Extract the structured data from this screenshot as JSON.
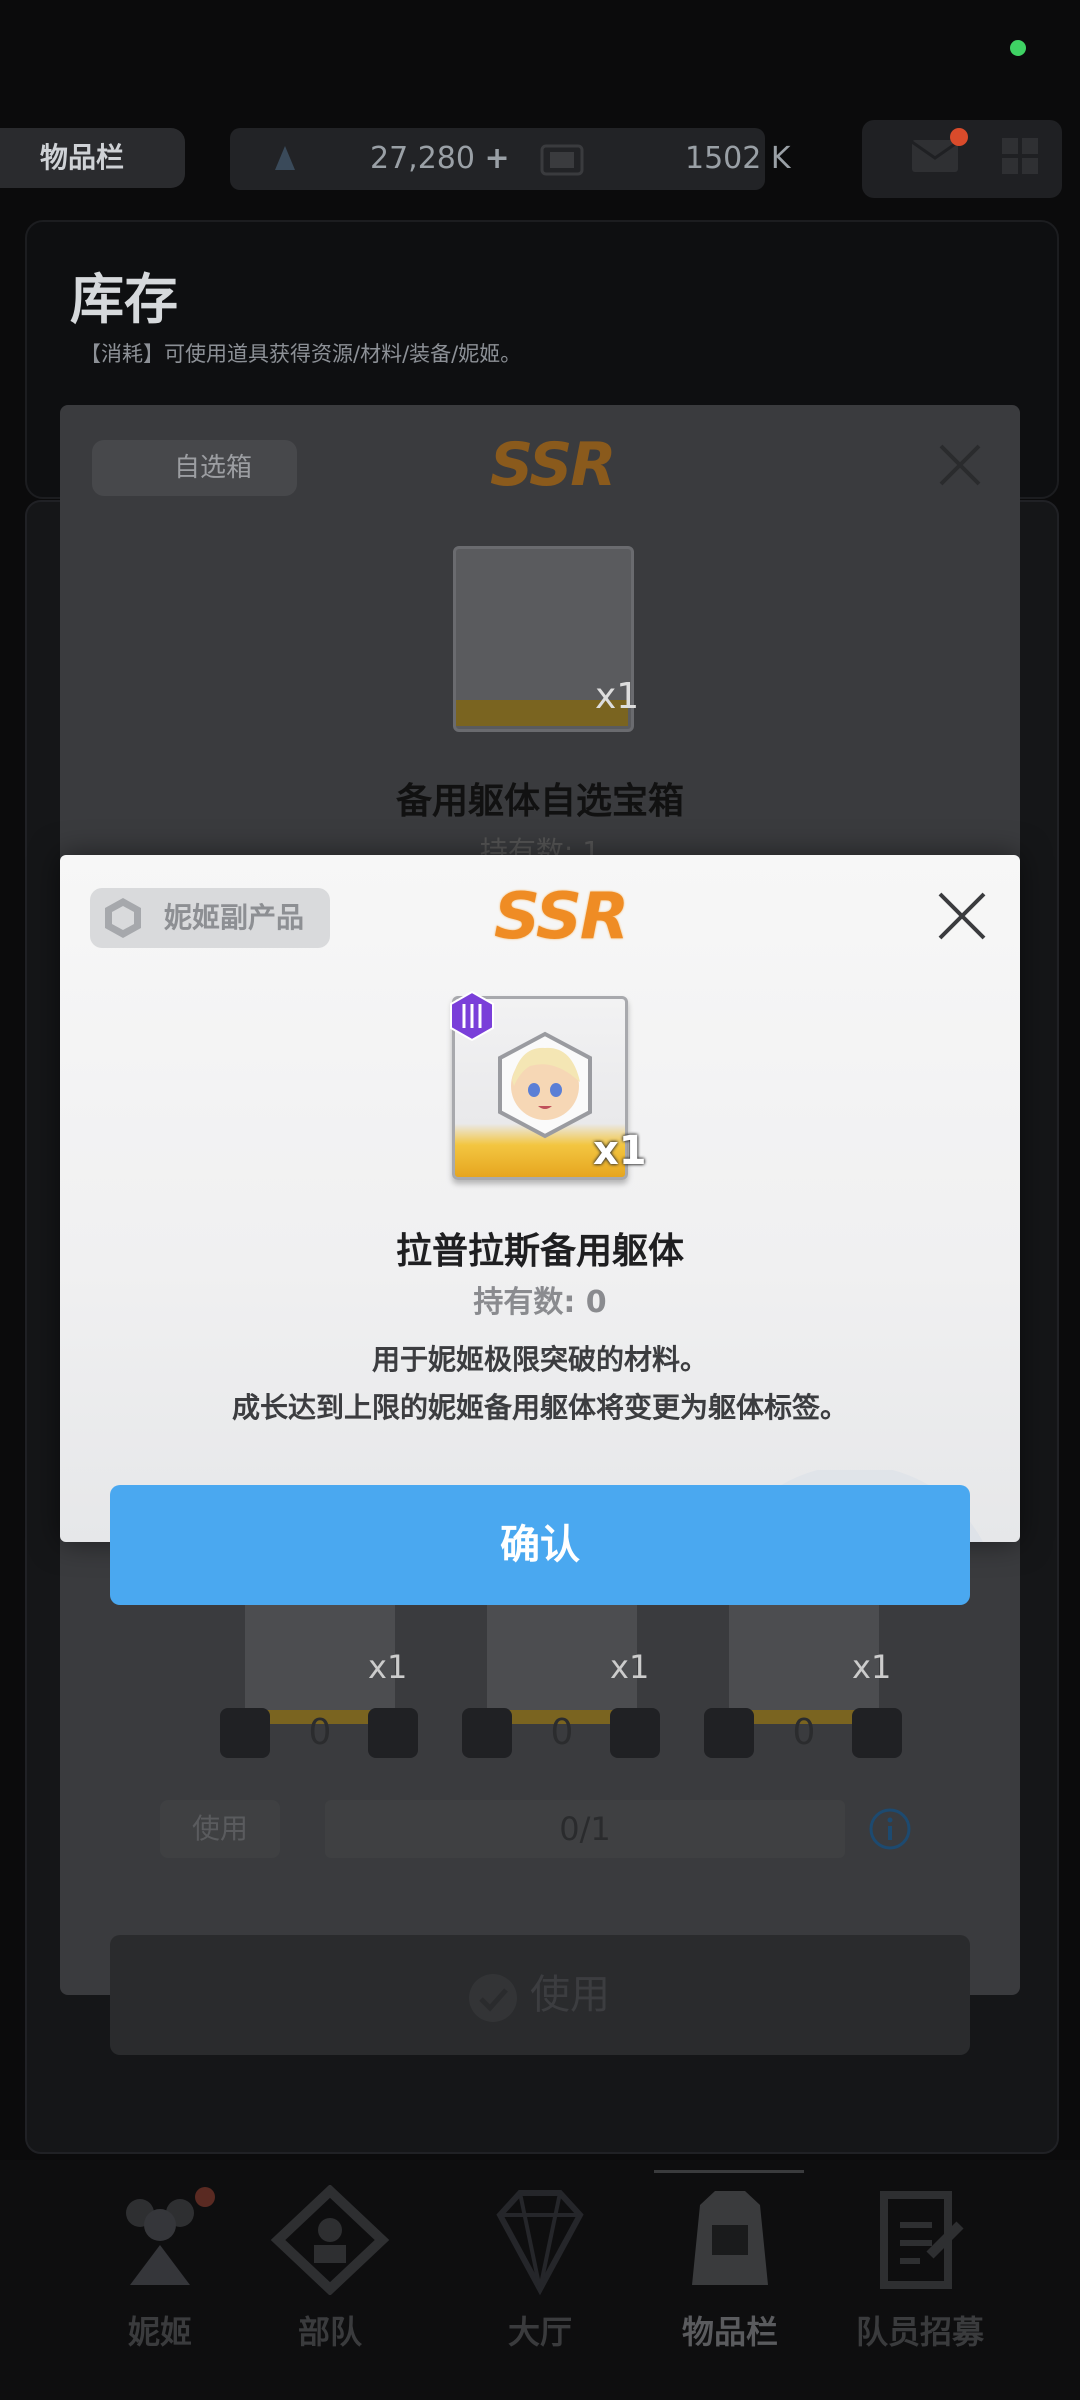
{
  "topbar": {
    "menu_label": "物品栏",
    "resource1_value": "27,280",
    "resource1_plus": "+",
    "resource2_value": "1502 K"
  },
  "inventory": {
    "title": "库存",
    "subtitle": "【消耗】可使用道具获得资源/材料/装备/妮姬。"
  },
  "background_dialog": {
    "tag_label": "自选箱",
    "rarity": "SSR",
    "item_name": "备用躯体自选宝箱",
    "held_label": "持有数: 1",
    "choice_qty_label": "x1",
    "pick_cards": [
      {
        "qty": "x1",
        "count": "0"
      },
      {
        "qty": "x1",
        "count": "0"
      },
      {
        "qty": "x1",
        "count": "0"
      }
    ],
    "use_small_label": "使用",
    "selection_count": "0/1",
    "use_button_label": "使用"
  },
  "dialog": {
    "tag_label": "妮姬副产品",
    "rarity": "SSR",
    "rarity_color": "#ef8c24",
    "item_qty": "x1",
    "item_name": "拉普拉斯备用躯体",
    "held_label": "持有数: 0",
    "description_line1": "用于妮姬极限突破的材料。",
    "description_line2": "成长达到上限的妮姬备用躯体将变更为躯体标签。",
    "confirm_label": "确认",
    "confirm_color": "#4aa8f0"
  },
  "nav": {
    "items": [
      {
        "label": "妮姬",
        "icon": "nikke-icon"
      },
      {
        "label": "部队",
        "icon": "squad-icon"
      },
      {
        "label": "大厅",
        "icon": "lobby-icon"
      },
      {
        "label": "物品栏",
        "icon": "inventory-icon"
      },
      {
        "label": "队员招募",
        "icon": "recruit-icon"
      }
    ]
  }
}
